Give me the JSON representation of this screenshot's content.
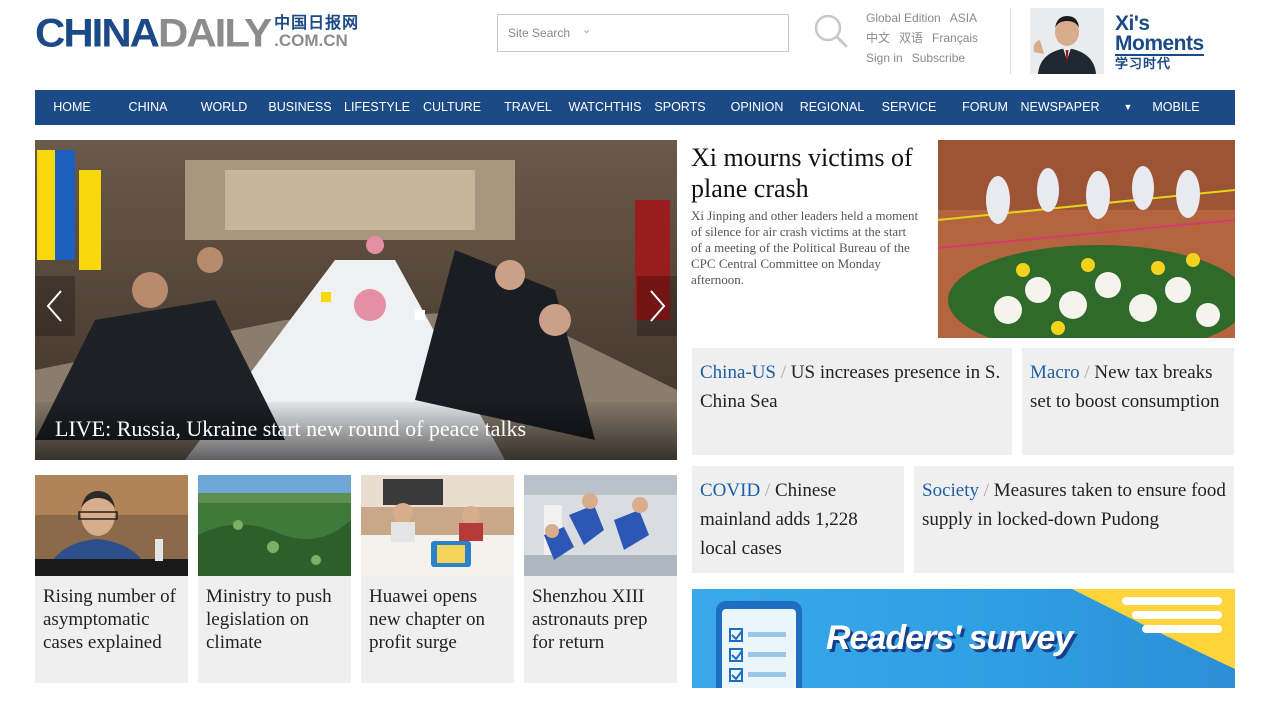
{
  "header": {
    "logo_china": "CHINA",
    "logo_daily": "DAILY",
    "logo_cn": "中国日报网",
    "logo_domain": ".COM.CN",
    "search": {
      "placeholder": "Site Search",
      "dropdown_icon": "chevron-down-icon",
      "button_icon": "search-icon"
    },
    "edition_links": [
      [
        "Global Edition",
        "ASIA"
      ],
      [
        "中文",
        "双语",
        "Français"
      ],
      [
        "Sign in",
        "Subscribe"
      ]
    ],
    "xi_moments": {
      "line1": "Xi's",
      "line2": "Moments",
      "line3": "学习时代"
    }
  },
  "nav": {
    "items": [
      "HOME",
      "CHINA",
      "WORLD",
      "BUSINESS",
      "LIFESTYLE",
      "CULTURE",
      "TRAVEL",
      "WATCHTHIS",
      "SPORTS",
      "OPINION",
      "REGIONAL",
      "SERVICE",
      "FORUM",
      "NEWSPAPER",
      "MOBILE"
    ],
    "more_icon": "caret-down-icon"
  },
  "hero": {
    "caption": "LIVE: Russia, Ukraine start new round of peace talks",
    "prev_icon": "chevron-left-icon",
    "next_icon": "chevron-right-icon"
  },
  "top_story": {
    "title": "Xi mourns victims of plane crash",
    "summary": "Xi Jinping and other leaders held a moment of silence for air crash victims at the start of a meeting of the Political Bureau of the CPC Central Committee on Monday afternoon."
  },
  "boxes": [
    {
      "category": "China-US",
      "text": "US increases presence in S. China Sea"
    },
    {
      "category": "Macro",
      "text": "New tax breaks set to boost consumption"
    },
    {
      "category": "COVID",
      "text": "Chinese mainland adds 1,228 local cases"
    },
    {
      "category": "Society",
      "text": "Measures taken to ensure food supply in locked-down Pudong"
    }
  ],
  "separator": "/",
  "cards": [
    {
      "title": "Rising number of asymptomatic cases explained"
    },
    {
      "title": "Ministry to push legislation on climate"
    },
    {
      "title": "Huawei opens new chapter on profit surge"
    },
    {
      "title": "Shenzhou XIII astronauts prep for return"
    }
  ],
  "banner": {
    "text": "Readers' survey"
  },
  "colors": {
    "brand_blue": "#1c4a86",
    "link_blue": "#1c5ea8",
    "box_gray": "#efefef",
    "banner_blue": "#2ba7e8"
  }
}
